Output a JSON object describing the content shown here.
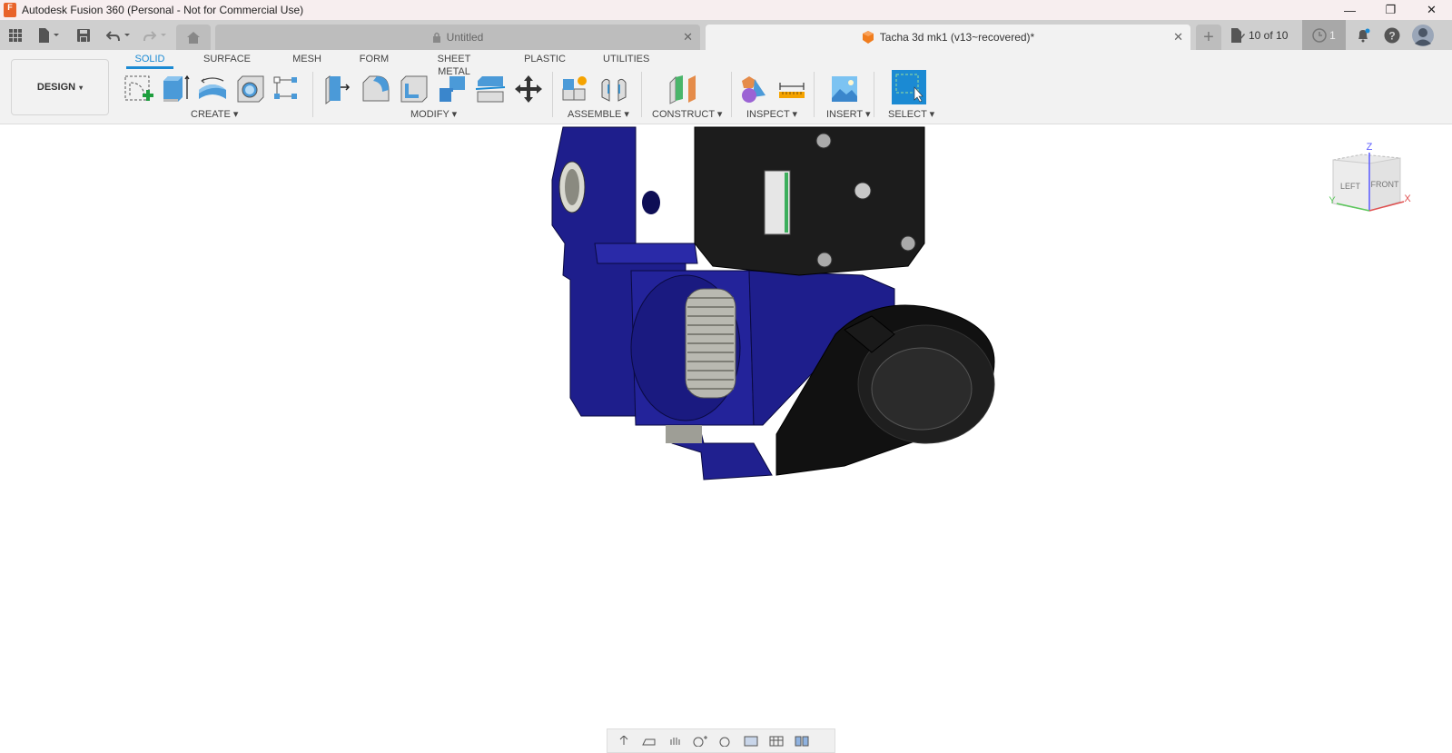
{
  "window": {
    "title": "Autodesk Fusion 360 (Personal - Not for Commercial Use)",
    "logo_letter": "F",
    "controls": {
      "minimize": "—",
      "maximize": "❐",
      "close": "✕"
    }
  },
  "tabbar": {
    "tabs": [
      {
        "label": "Untitled",
        "icon": "lock-icon",
        "active": false
      },
      {
        "label": "Tacha 3d mk1 (v13~recovered)*",
        "icon": "component-cube-icon",
        "active": true
      }
    ],
    "close_glyph": "✕",
    "new_tab_glyph": "+",
    "version_label": "10 of 10",
    "jobs_count": "1"
  },
  "toolbar": {
    "workspace_label": "DESIGN",
    "workspace_tabs": [
      {
        "label": "SOLID",
        "active": true
      },
      {
        "label": "SURFACE",
        "active": false
      },
      {
        "label": "MESH",
        "active": false
      },
      {
        "label": "FORM",
        "active": false
      },
      {
        "label": "SHEET METAL",
        "active": false
      },
      {
        "label": "PLASTIC",
        "active": false
      },
      {
        "label": "UTILITIES",
        "active": false
      }
    ],
    "groups": {
      "create": "CREATE",
      "modify": "MODIFY",
      "assemble": "ASSEMBLE",
      "construct": "CONSTRUCT",
      "inspect": "INSPECT",
      "insert": "INSERT",
      "select": "SELECT"
    },
    "dropdown_glyph": "▾"
  },
  "viewcube": {
    "faces": {
      "left": "LEFT",
      "front": "FRONT"
    },
    "axes": {
      "x": "X",
      "y": "Y",
      "z": "Z"
    },
    "colors": {
      "x": "#e05050",
      "y": "#5cc85c",
      "z": "#5a5aff"
    }
  },
  "model": {
    "body_color": "#1e1e8c",
    "motor_color": "#1c1c1c"
  },
  "accent_color": "#1b8ad3"
}
